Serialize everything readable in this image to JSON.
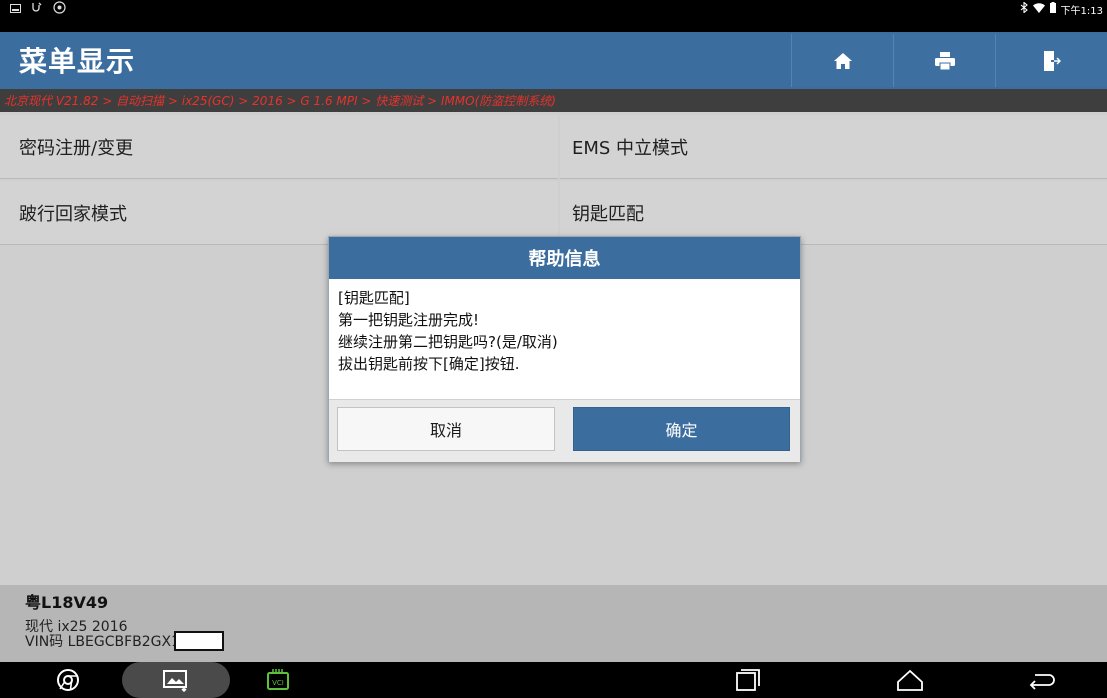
{
  "status_bar": {
    "time": "下午1:13",
    "icons_left": [
      "gallery-icon",
      "usb-icon",
      "settings-badge-icon"
    ],
    "icons_right": [
      "bluetooth-icon",
      "wifi-icon",
      "battery-icon"
    ]
  },
  "header": {
    "title": "菜单显示",
    "buttons": [
      {
        "name": "home-button",
        "icon": "home-icon"
      },
      {
        "name": "print-button",
        "icon": "print-icon"
      },
      {
        "name": "exit-button",
        "icon": "exit-icon"
      }
    ]
  },
  "breadcrumb": {
    "text": "北京现代 V21.82 > 自动扫描 > ix25(GC) > 2016 > G 1.6 MPI > 快速测试 > IMMO(防盗控制系统)"
  },
  "menu": {
    "items": [
      {
        "label": "密码注册/变更"
      },
      {
        "label": "EMS 中立模式"
      },
      {
        "label": "跛行回家模式"
      },
      {
        "label": "钥匙匹配"
      }
    ]
  },
  "dialog": {
    "title": "帮助信息",
    "lines": [
      "[钥匙匹配]",
      "第一把钥匙注册完成!",
      "继续注册第二把钥匙吗?(是/取消)",
      "拔出钥匙前按下[确定]按钮."
    ],
    "cancel_label": "取消",
    "ok_label": "确定"
  },
  "vehicle": {
    "plate": "粤L18V49",
    "model": "现代 ix25 2016",
    "vin": "VIN码 LBEGCBFB2GX1"
  },
  "nav_bar": {
    "items": [
      "chrome-icon",
      "screenshot-icon",
      "vci-icon",
      "recents-icon",
      "home-icon",
      "back-icon"
    ],
    "vci_label": "VCI"
  },
  "colors": {
    "header_blue": "#3c6d9f",
    "breadcrumb_red": "#e8322b",
    "menu_bg": "#d3d3d3",
    "vci_green": "#5cc23a"
  }
}
